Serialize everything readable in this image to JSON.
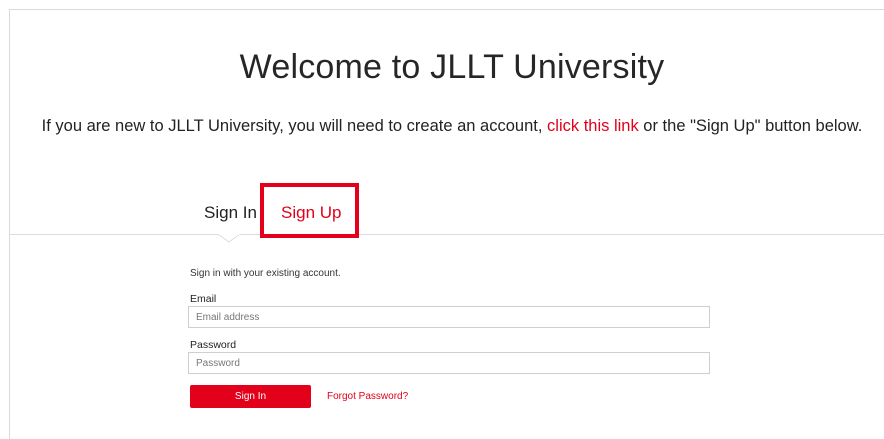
{
  "header": {
    "title": "Welcome to JLLT University",
    "intro_before": "If you are new to JLLT University, you will need to create an account, ",
    "intro_link": "click this link",
    "intro_after": " or the \"Sign Up\" button below."
  },
  "tabs": {
    "sign_in": "Sign In",
    "sign_up": "Sign Up"
  },
  "form": {
    "hint": "Sign in with your existing account.",
    "email_label": "Email",
    "email_placeholder": "Email address",
    "email_value": "",
    "password_label": "Password",
    "password_placeholder": "Password",
    "password_value": "",
    "submit_label": "Sign In",
    "forgot_label": "Forgot Password?"
  },
  "colors": {
    "accent": "#e3001b",
    "highlight_box": "#e3001b",
    "text": "#222222",
    "border": "#cfcfcf"
  }
}
